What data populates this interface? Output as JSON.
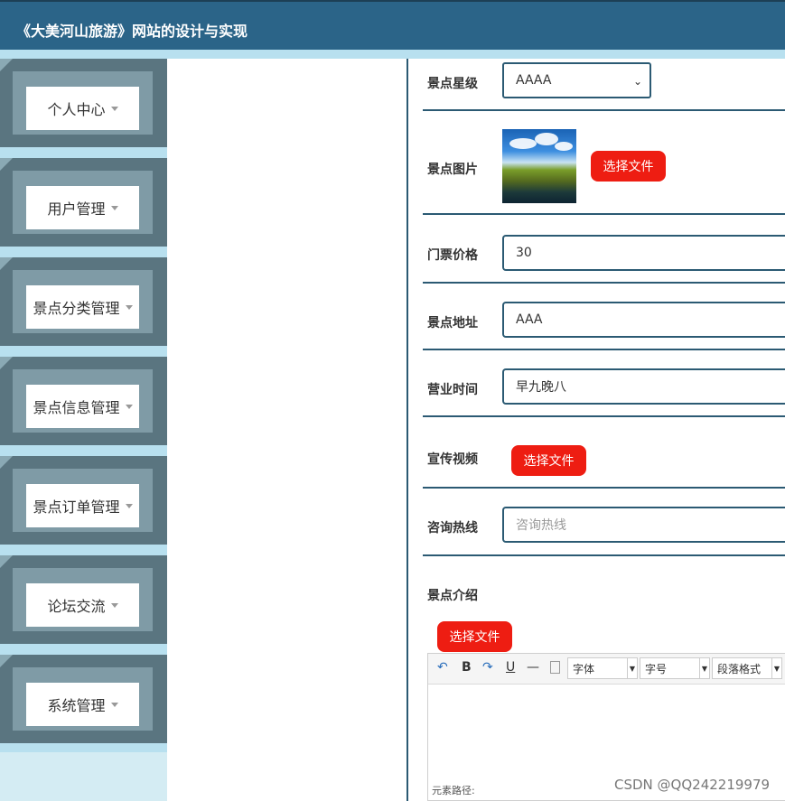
{
  "app": {
    "title": "《大美河山旅游》网站的设计与实现"
  },
  "sidebar": {
    "items": [
      {
        "label": "个人中心"
      },
      {
        "label": "用户管理"
      },
      {
        "label": "景点分类管理"
      },
      {
        "label": "景点信息管理"
      },
      {
        "label": "景点订单管理"
      },
      {
        "label": "论坛交流"
      },
      {
        "label": "系统管理"
      }
    ]
  },
  "form": {
    "rating": {
      "label": "景点星级",
      "value": "AAAA"
    },
    "image": {
      "label": "景点图片",
      "button": "选择文件"
    },
    "price": {
      "label": "门票价格",
      "value": "30"
    },
    "address": {
      "label": "景点地址",
      "value": "AAA"
    },
    "hours": {
      "label": "营业时间",
      "value": "早九晚八"
    },
    "video": {
      "label": "宣传视频",
      "button": "选择文件"
    },
    "hotline": {
      "label": "咨询热线",
      "placeholder": "咨询热线"
    },
    "intro": {
      "label": "景点介绍",
      "button": "选择文件"
    }
  },
  "editor": {
    "toolbar": {
      "bold": "B",
      "underline": "U",
      "hr": "—",
      "font": "字体",
      "size": "字号",
      "format": "段落格式"
    },
    "path_label": "元素路径:"
  },
  "watermark": "CSDN @QQ242219979"
}
